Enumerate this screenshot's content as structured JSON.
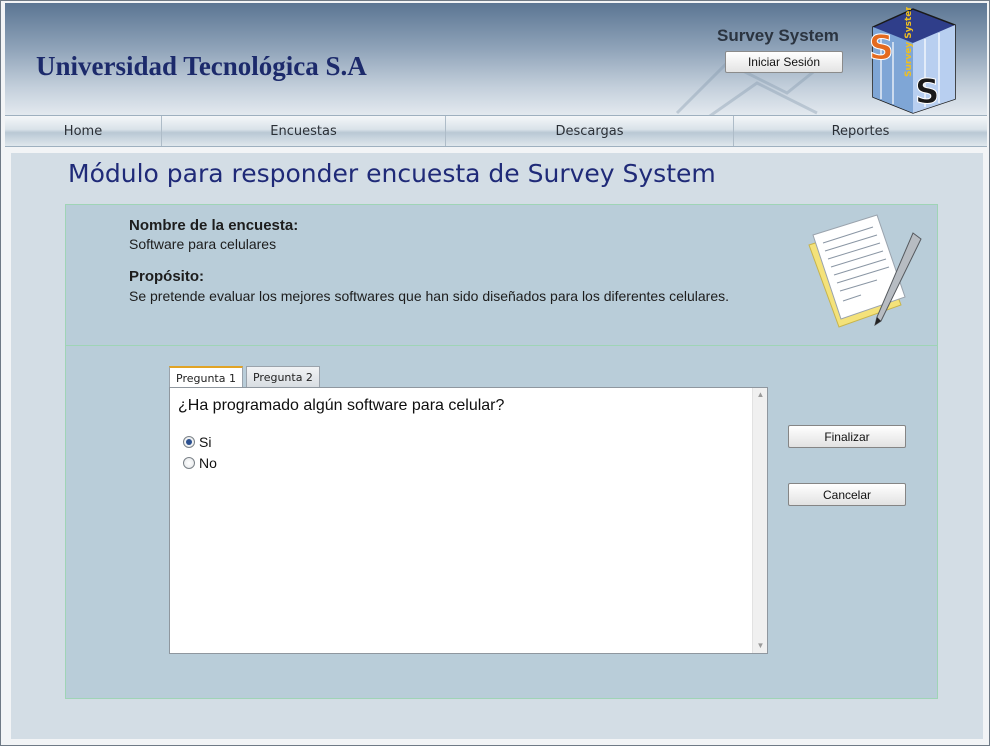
{
  "header": {
    "site_title": "Universidad Tecnológica S.A",
    "brand_label": "Survey System",
    "login_button": "Iniciar Sesión",
    "logo_letters": "S S",
    "logo_text": "Survey System"
  },
  "nav": {
    "items": [
      {
        "label": "Home"
      },
      {
        "label": "Encuestas"
      },
      {
        "label": "Descargas"
      },
      {
        "label": "Reportes"
      }
    ]
  },
  "main": {
    "heading": "Módulo para responder encuesta de Survey System",
    "survey": {
      "name_label": "Nombre de la encuesta:",
      "name_value": "Software para celulares",
      "purpose_label": "Propósito:",
      "purpose_value": "Se pretende evaluar los mejores softwares que han sido diseñados para los diferentes celulares."
    },
    "tabs": [
      {
        "label": "Pregunta 1",
        "active": true
      },
      {
        "label": "Pregunta 2",
        "active": false
      }
    ],
    "question": {
      "text": "¿Ha programado algún software para celular?",
      "options": [
        {
          "label": "Si",
          "selected": true
        },
        {
          "label": "No",
          "selected": false
        }
      ]
    },
    "buttons": {
      "finish": "Finalizar",
      "cancel": "Cancelar"
    }
  },
  "colors": {
    "title_blue": "#1c2a6b",
    "heading_blue": "#1f2a78",
    "panel_bg": "#b9cdd9",
    "tab_active_accent": "#e1a325",
    "logo_orange": "#e46a1f"
  }
}
